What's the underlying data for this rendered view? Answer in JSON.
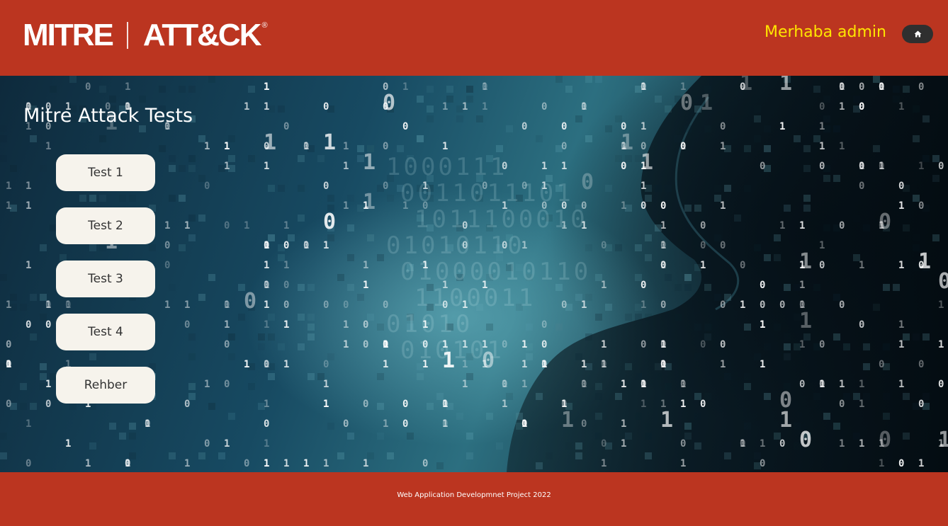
{
  "header": {
    "logo_left": "MITRE",
    "logo_right": "ATT&CK",
    "logo_mark": "®",
    "greeting": "Merhaba admin",
    "home_icon": "home-icon"
  },
  "main": {
    "title": "Mitre Attack Tests",
    "buttons": [
      "Test 1",
      "Test 2",
      "Test 3",
      "Test 4",
      "Rehber"
    ]
  },
  "footer": {
    "text": "Web Application Developmnet Project 2022"
  },
  "colors": {
    "brand": "#bb3520",
    "greeting": "#ffe600",
    "button_bg": "#f6f3ec",
    "home_button_bg": "#2f2f2f"
  }
}
